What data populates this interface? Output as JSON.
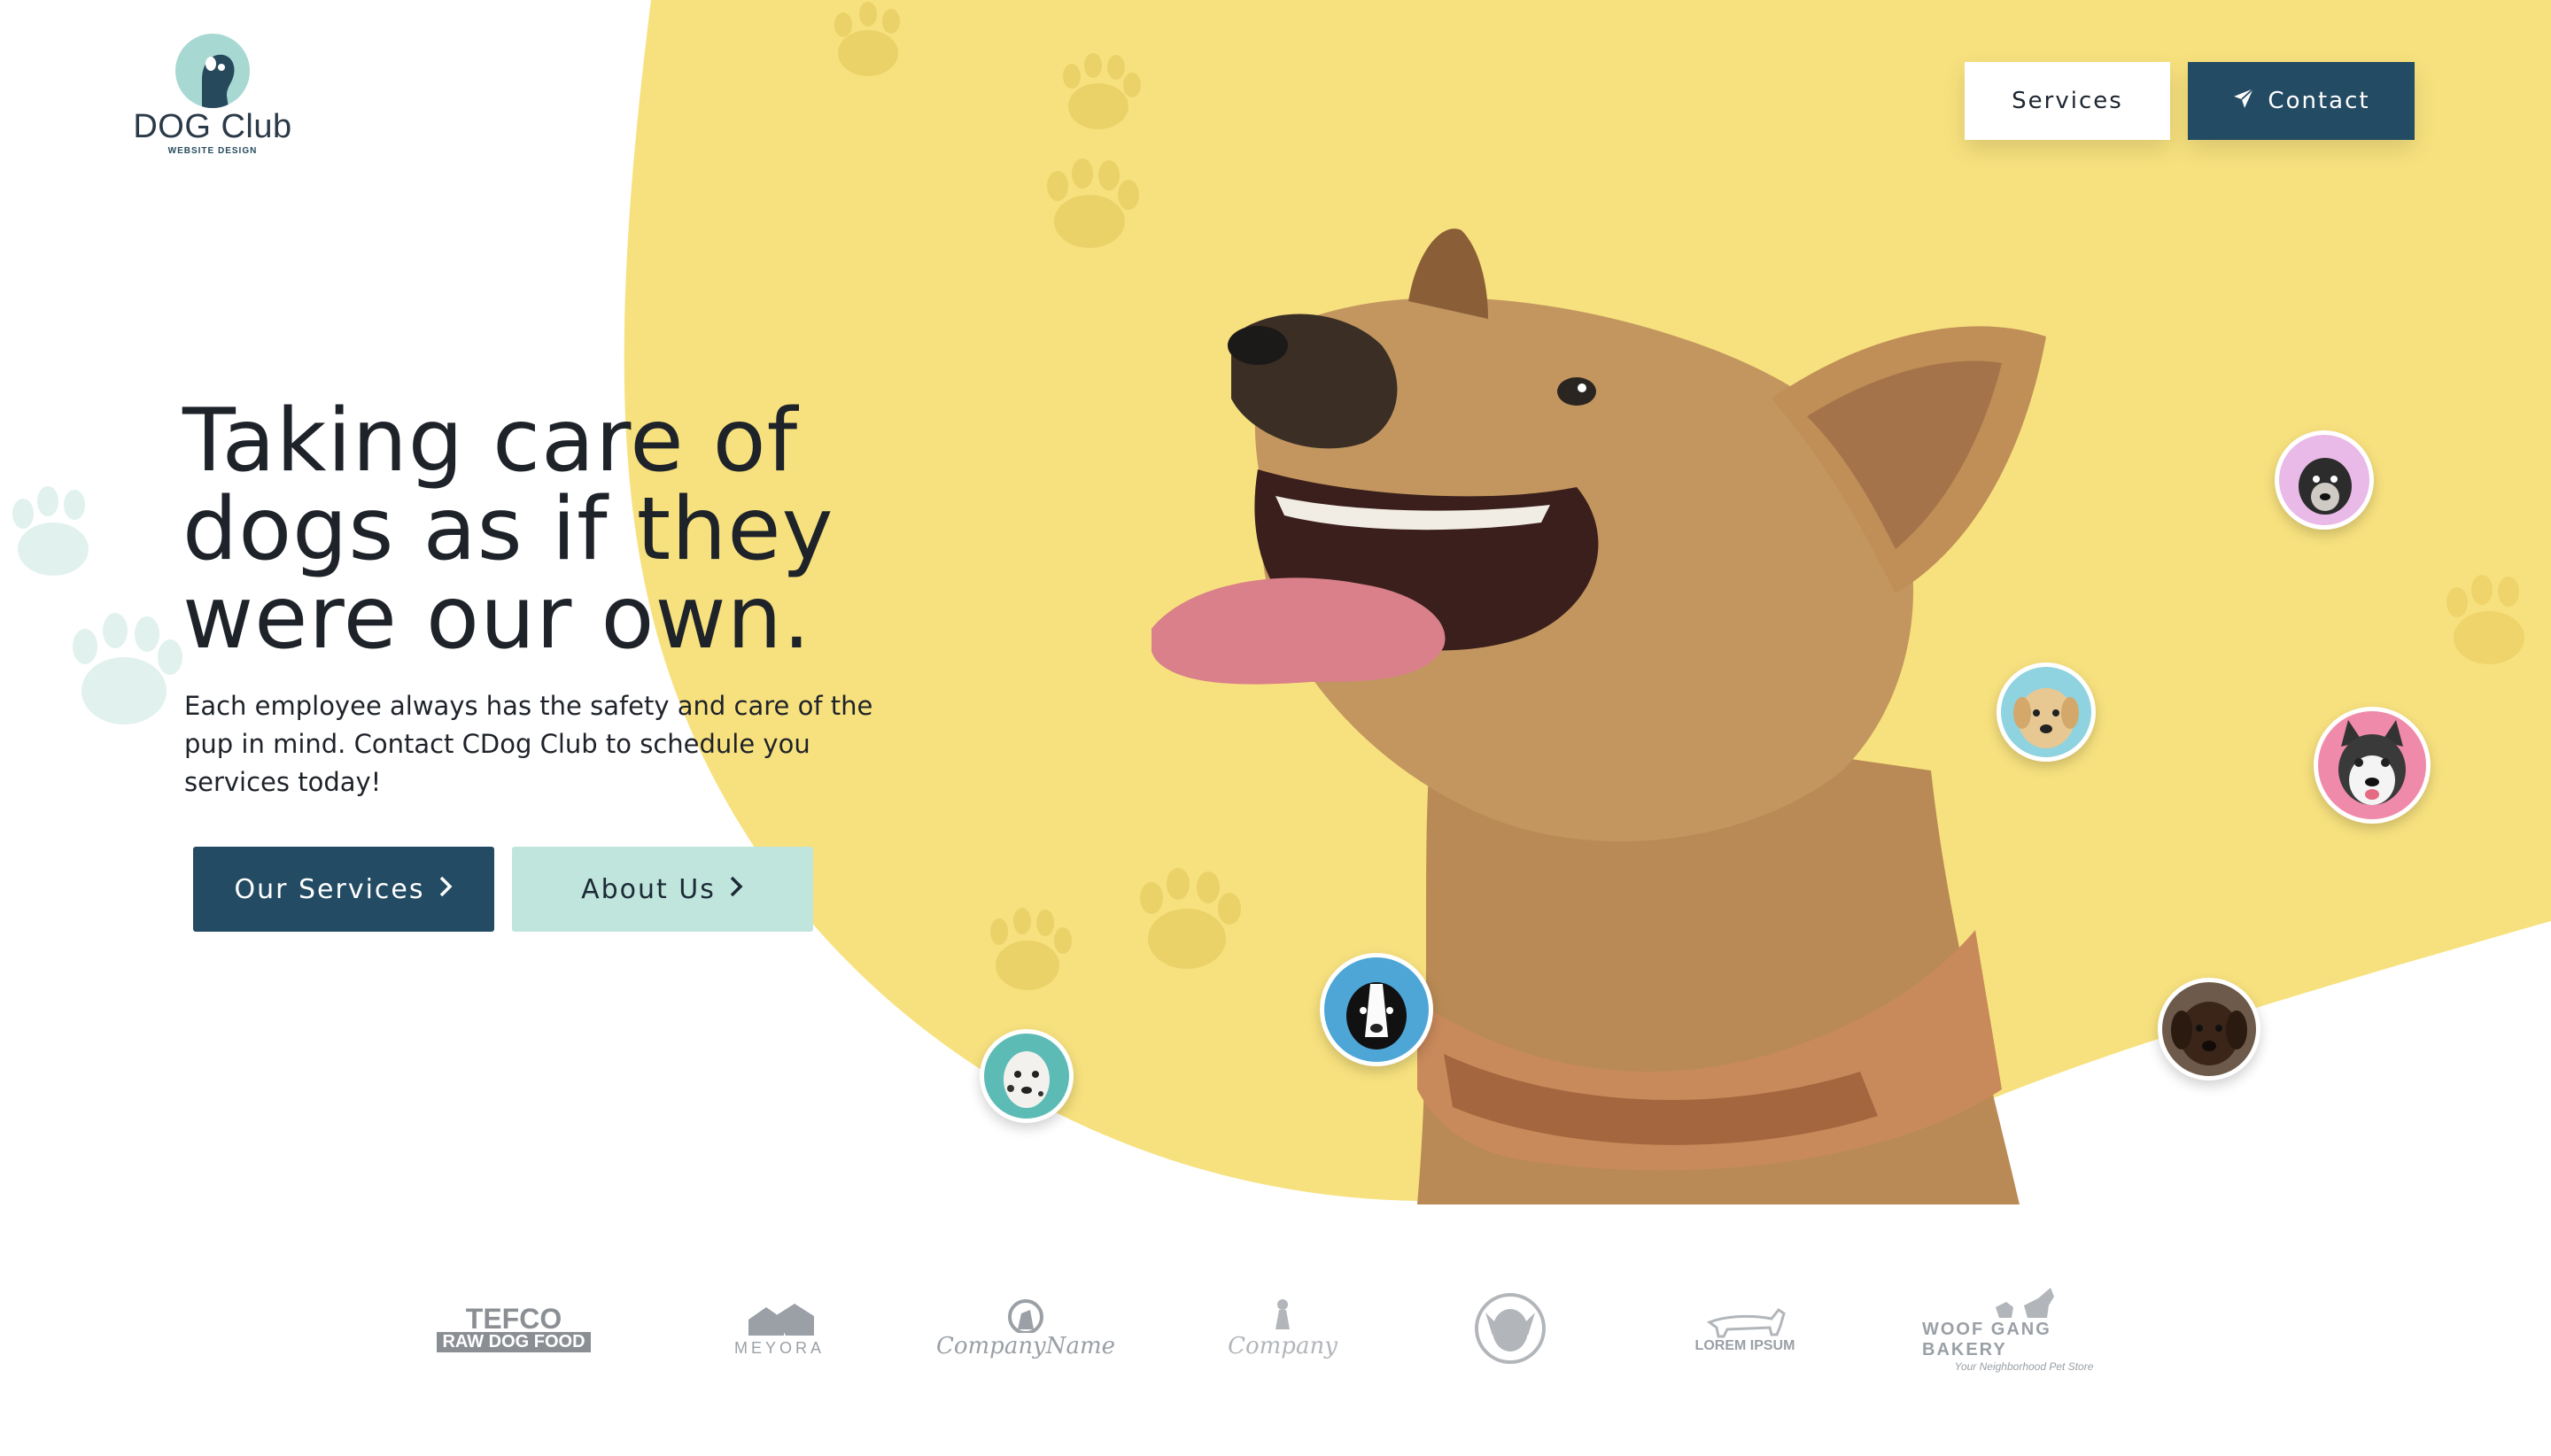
{
  "brand": {
    "name": "DOG Club",
    "tagline": "WEBSITE DESIGN"
  },
  "nav": {
    "services_label": "Services",
    "contact_label": "Contact"
  },
  "hero": {
    "headline": [
      "Taking care of",
      "dogs as if they",
      "were our own."
    ],
    "lede": [
      "Each employee always has the safety and care of the",
      "pup in mind. Contact CDog Club to schedule you",
      "services today!"
    ],
    "primary_cta": "Our Services",
    "secondary_cta": "About Us"
  },
  "partners": [
    {
      "line1": "TEFCO",
      "line2": "RAW DOG FOOD"
    },
    {
      "line1": "MEYORA",
      "line2": ""
    },
    {
      "line1": "CompanyName",
      "line2": ""
    },
    {
      "line1": "Company",
      "line2": ""
    },
    {
      "line1": "",
      "line2": ""
    },
    {
      "line1": "LOREM IPSUM",
      "line2": ""
    },
    {
      "line1": "WOOF GANG BAKERY",
      "line2": "Your Neighborhood Pet Store"
    }
  ],
  "colors": {
    "accent_yellow": "#f7e17e",
    "primary_navy": "#234b63",
    "mint": "#bfe5dc",
    "text": "#1e2229"
  },
  "icons": {
    "contact": "paper-plane-icon",
    "cta_arrow": "chevron-right-icon"
  }
}
